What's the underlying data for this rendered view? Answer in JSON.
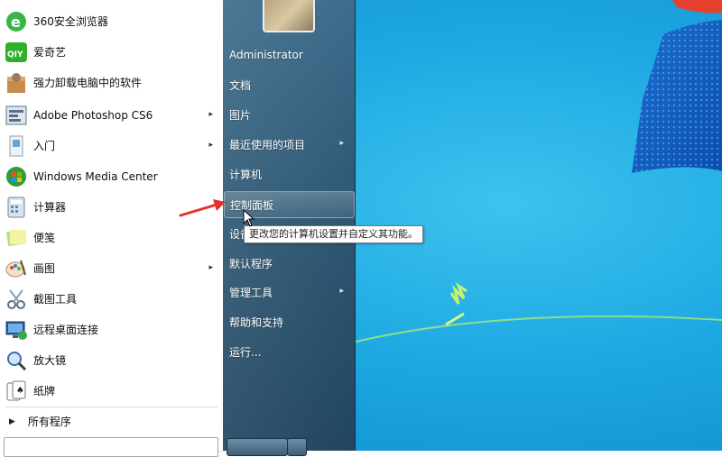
{
  "start_menu": {
    "programs": [
      {
        "label": "360安全浏览器",
        "icon": "browser-360-icon",
        "has_submenu": false
      },
      {
        "label": "爱奇艺",
        "icon": "iqiyi-icon",
        "has_submenu": false
      },
      {
        "label": "强力卸载电脑中的软件",
        "icon": "uninstaller-icon",
        "has_submenu": false
      },
      {
        "label": "Adobe Photoshop CS6",
        "icon": "photoshop-icon",
        "has_submenu": true
      },
      {
        "label": "入门",
        "icon": "getting-started-icon",
        "has_submenu": true
      },
      {
        "label": "Windows Media Center",
        "icon": "media-center-icon",
        "has_submenu": false
      },
      {
        "label": "计算器",
        "icon": "calculator-icon",
        "has_submenu": false
      },
      {
        "label": "便笺",
        "icon": "sticky-notes-icon",
        "has_submenu": false
      },
      {
        "label": "画图",
        "icon": "paint-icon",
        "has_submenu": true
      },
      {
        "label": "截图工具",
        "icon": "snipping-tool-icon",
        "has_submenu": false
      },
      {
        "label": "远程桌面连接",
        "icon": "remote-desktop-icon",
        "has_submenu": false
      },
      {
        "label": "放大镜",
        "icon": "magnifier-icon",
        "has_submenu": false
      },
      {
        "label": "纸牌",
        "icon": "solitaire-icon",
        "has_submenu": false
      }
    ],
    "all_programs_label": "所有程序",
    "right_items": [
      {
        "label": "Administrator",
        "has_submenu": false
      },
      {
        "label": "文档",
        "has_submenu": false
      },
      {
        "label": "图片",
        "has_submenu": false
      },
      {
        "label": "最近使用的项目",
        "has_submenu": true
      },
      {
        "label": "计算机",
        "has_submenu": false
      },
      {
        "label": "控制面板",
        "has_submenu": false,
        "highlighted": true
      },
      {
        "label": "设备",
        "has_submenu": false
      },
      {
        "label": "默认程序",
        "has_submenu": false
      },
      {
        "label": "管理工具",
        "has_submenu": true
      },
      {
        "label": "帮助和支持",
        "has_submenu": false
      },
      {
        "label": "运行...",
        "has_submenu": false
      }
    ],
    "tooltip": "更改您的计算机设置并自定义其功能。"
  },
  "colors": {
    "desktop": "#1ea9e2",
    "right_pane": "#2e5874",
    "annotation_arrow": "#e2332b"
  }
}
